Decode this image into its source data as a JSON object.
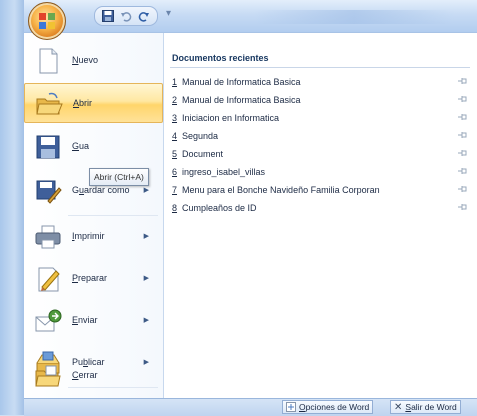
{
  "quick_access": {
    "icons": [
      "save-icon",
      "undo-icon",
      "redo-icon",
      "customize-icon"
    ]
  },
  "menu": {
    "items": [
      {
        "key": "nuevo",
        "label_pre": "",
        "label_ul": "N",
        "label_post": "uevo",
        "icon": "new-document-icon",
        "arrow": false
      },
      {
        "key": "abrir",
        "label_pre": "",
        "label_ul": "A",
        "label_post": "brir",
        "icon": "open-folder-icon",
        "arrow": false
      },
      {
        "key": "guardar",
        "label_pre": "",
        "label_ul": "G",
        "label_post": "uardar",
        "icon": "save-disk-icon",
        "arrow": false
      },
      {
        "key": "guardar-como",
        "label_pre": "G",
        "label_ul": "u",
        "label_post": "ardar como",
        "icon": "save-as-icon",
        "arrow": true
      },
      {
        "key": "imprimir",
        "label_pre": "",
        "label_ul": "I",
        "label_post": "mprimir",
        "icon": "printer-icon",
        "arrow": true
      },
      {
        "key": "preparar",
        "label_pre": "",
        "label_ul": "P",
        "label_post": "reparar",
        "icon": "prepare-icon",
        "arrow": true
      },
      {
        "key": "enviar",
        "label_pre": "",
        "label_ul": "E",
        "label_post": "nviar",
        "icon": "send-icon",
        "arrow": true
      },
      {
        "key": "publicar",
        "label_pre": "Pu",
        "label_ul": "b",
        "label_post": "licar",
        "icon": "publish-icon",
        "arrow": true
      },
      {
        "key": "cerrar",
        "label_pre": "",
        "label_ul": "C",
        "label_post": "errar",
        "icon": "close-folder-icon",
        "arrow": false
      }
    ],
    "tooltip": "Abrir (Ctrl+A)",
    "guardar_visible": "Gua"
  },
  "recent": {
    "title": "Documentos recientes",
    "documents": [
      {
        "num": "1",
        "name": "Manual de Informatica Basica"
      },
      {
        "num": "2",
        "name": "Manual de Informatica Basica"
      },
      {
        "num": "3",
        "name": "Iniciacion en Informatica"
      },
      {
        "num": "4",
        "name": "Segunda"
      },
      {
        "num": "5",
        "name": "Document"
      },
      {
        "num": "6",
        "name": "ingreso_isabel_villas"
      },
      {
        "num": "7",
        "name": "Menu para el Bonche Navideño Familia Corporan"
      },
      {
        "num": "8",
        "name": "Cumpleaños de ID"
      }
    ]
  },
  "footer": {
    "options_ul": "O",
    "options_rest": "pciones de Word",
    "exit_ul": "S",
    "exit_rest": "alir de Word"
  },
  "colors": {
    "hover_gradient": "#ffe8a2",
    "menu_text": "#1c2a44",
    "title_bar": "#c7dbf4"
  }
}
